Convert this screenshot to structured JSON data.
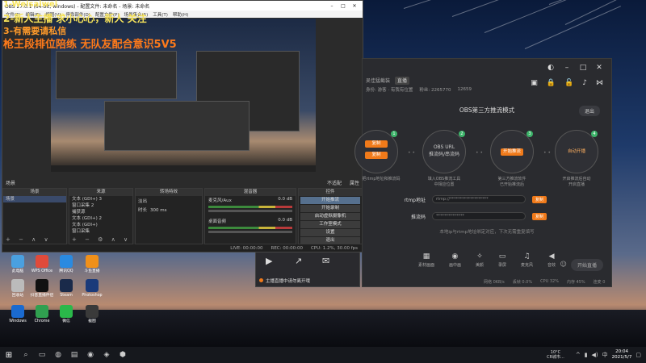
{
  "overlay": {
    "line1": "1-Weisaiwei",
    "line2": "2-新人主播 求小心心，新人 关注",
    "line3": "3-有需要请私信",
    "line4": "枪王段排位陪练 无队友配合意识5V5"
  },
  "obs": {
    "title": "OBS 27.0.1 (64-bit, windows) - 配置文件: 未命名 - 场景: 未命名",
    "menu": [
      "文件(F)",
      "编辑(E)",
      "视图(V)",
      "停靠部件(D)",
      "配置文件(P)",
      "场景集合(S)",
      "工具(T)",
      "帮助(H)"
    ],
    "mode_toggle": "不适配",
    "audio_mode": "属性",
    "docks": {
      "scenes": {
        "title": "场景",
        "items": [
          "场景"
        ]
      },
      "sources": {
        "title": "来源",
        "items": [
          "文本 (GDI+) 3",
          "窗口采集 2",
          "捕获源",
          "文本 (GDI+) 2",
          "文本 (GDI+)",
          "窗口采集"
        ]
      },
      "transitions": {
        "title": "转场特效",
        "type": "淡出",
        "duration_label": "时长",
        "duration_value": "300 ms"
      },
      "mixer": {
        "title": "混音器",
        "channels": [
          {
            "name": "麦克风/Aux",
            "db": "0.0 dB"
          },
          {
            "name": "桌面音频",
            "db": "0.0 dB"
          }
        ]
      },
      "controls": {
        "title": "控件",
        "buttons": [
          "开始推流",
          "开始录制",
          "启动虚拟摄像机",
          "工作室模式",
          "设置",
          "退出"
        ]
      }
    },
    "status": {
      "live": "LIVE: 00:00:00",
      "rec": "REC: 00:00:00",
      "cpu": "CPU: 1.2%, 30.00 fps"
    }
  },
  "app": {
    "channel_name": "吴佳猛截装",
    "badge": "直播",
    "sub_left": "身份: 游客 · 有我有位置",
    "sub_fans": "粉丝: 2265770",
    "sub_hot": "12659",
    "mode_title": "OBS第三方推流模式",
    "exit": "退出",
    "steps": [
      {
        "num": "1",
        "label": "复制",
        "caption": "把rtmp地址和推流码"
      },
      {
        "num": "2",
        "label": "OBS URL\n推流码/串流码",
        "caption": "填入OBS推流工具\n中相应位置"
      },
      {
        "num": "3",
        "label": "开始推流",
        "caption": "第三方推流软件\n已开始推流后"
      },
      {
        "num": "4",
        "label": "自动开播",
        "caption": "开启推流后自动\n开启直播"
      }
    ],
    "rtmp_label": "rtmp地址",
    "rtmp_value": "rtmp://*******************",
    "key_label": "推流码",
    "key_value": "**************",
    "copy": "复制",
    "hint": "本地ip与rtmp地址绑定对应，下次无需重复填写",
    "tools": [
      "素材画面",
      "画中画",
      "美颜",
      "录屏",
      "麦克风",
      "音效"
    ],
    "start_live": "开始直播",
    "stats": [
      "网络 0KB/s",
      "丢帧 0.0%",
      "CPU 32%",
      "内存 45%",
      "连麦 0"
    ]
  },
  "popup": {
    "msg": "主播直播中请勿离开哦"
  },
  "desktop_icons": [
    {
      "label": "此电脑",
      "color": "#4aa0e0"
    },
    {
      "label": "WPS Office",
      "color": "#e04a3a"
    },
    {
      "label": "腾讯QQ",
      "color": "#2a8ae0"
    },
    {
      "label": "斗鱼直播",
      "color": "#f0901a"
    },
    {
      "label": "回收站",
      "color": "#bbbbbb"
    },
    {
      "label": "抖音直播伴侣",
      "color": "#111111"
    },
    {
      "label": "Steam",
      "color": "#1a2a4a"
    },
    {
      "label": "Photoshop",
      "color": "#1a3a7a"
    },
    {
      "label": "Windows",
      "color": "#1a6ad0"
    },
    {
      "label": "Chrome",
      "color": "#30a050"
    },
    {
      "label": "微信",
      "color": "#2ab84a"
    },
    {
      "label": "截图",
      "color": "#3a3a3a"
    },
    {
      "label": "穿越火线",
      "color": "#c07a1a"
    },
    {
      "label": "火影忍者",
      "color": "#c03a1a"
    },
    {
      "label": "腾讯视频",
      "color": "#e06a1a"
    },
    {
      "label": "直播助手",
      "color": "#5a4a3a"
    }
  ],
  "taskbar": {
    "weather_temp": "10°C",
    "weather_desc": "CR城市...",
    "time": "20:04",
    "date": "2021/5/7",
    "lang": "中"
  },
  "colors": {
    "accent": "#f07a1a",
    "app_bg": "#2a2b2f",
    "obs_bg": "#2b2b2b"
  }
}
